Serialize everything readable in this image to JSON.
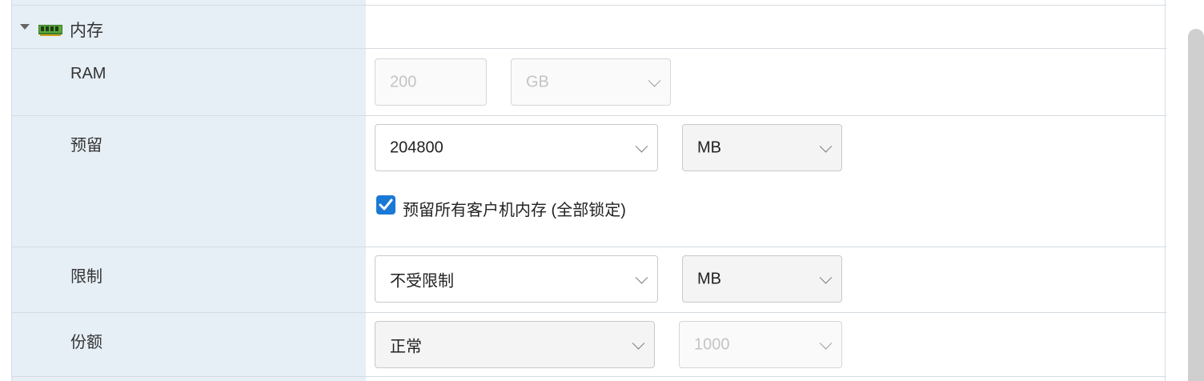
{
  "section": {
    "title": "内存",
    "icon": "ram-icon",
    "expand_icon": "triangle-down-icon"
  },
  "ram": {
    "label": "RAM",
    "value": "200",
    "unit": "GB"
  },
  "reservation": {
    "label": "预留",
    "value": "204800",
    "unit": "MB",
    "reserve_all_checked": true,
    "reserve_all_label": "预留所有客户机内存 (全部锁定)"
  },
  "limit": {
    "label": "限制",
    "value": "不受限制",
    "unit": "MB"
  },
  "shares": {
    "label": "份额",
    "value": "正常",
    "amount": "1000"
  },
  "colors": {
    "label_column": "#e6eef6",
    "checkbox": "#1b79d6",
    "border": "#d5dbe1"
  }
}
